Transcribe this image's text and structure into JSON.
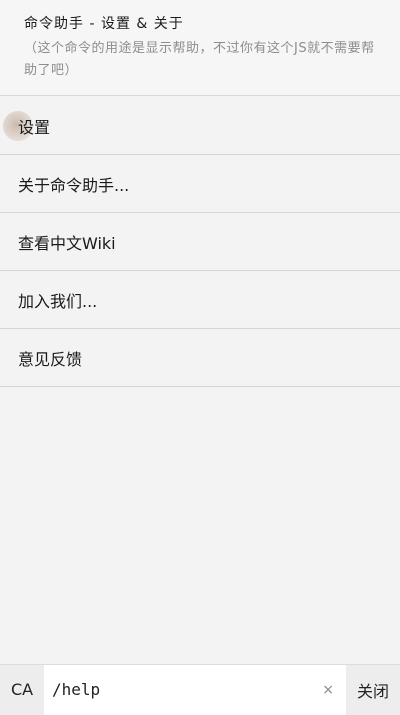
{
  "header": {
    "title": "命令助手 - 设置 & 关于",
    "subtitle": "（这个命令的用途是显示帮助，不过你有这个JS就不需要帮助了吧）"
  },
  "menu": {
    "items": [
      {
        "label": "设置"
      },
      {
        "label": "关于命令助手..."
      },
      {
        "label": "查看中文Wiki"
      },
      {
        "label": "加入我们..."
      },
      {
        "label": "意见反馈"
      }
    ]
  },
  "bottom_bar": {
    "ca_label": "CA",
    "command_value": "/help",
    "clear_icon": "×",
    "close_label": "关闭"
  }
}
